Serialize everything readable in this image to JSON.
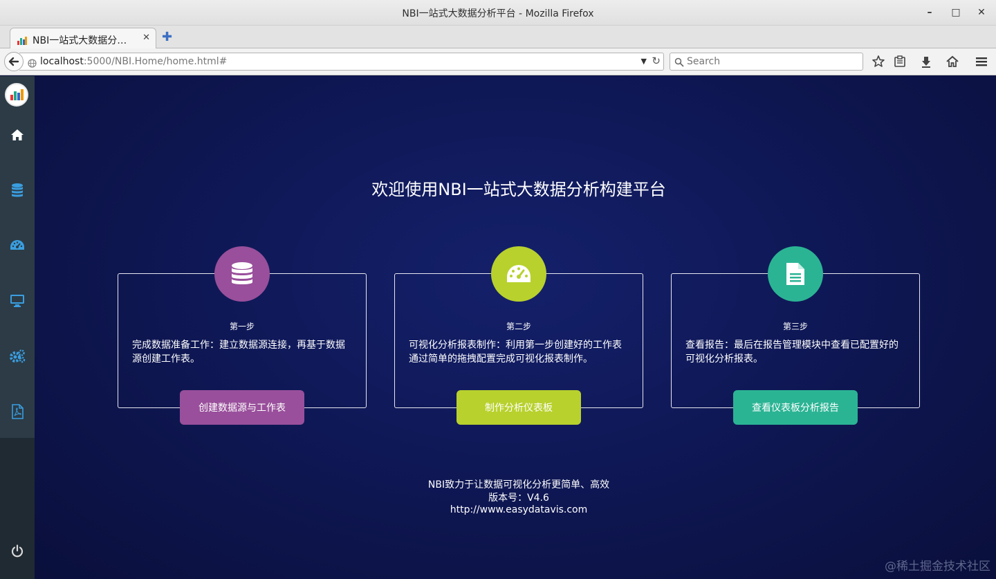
{
  "window": {
    "title": "NBI一站式大数据分析平台 - Mozilla Firefox",
    "minimize": "–",
    "maximize": "□",
    "close": "✕"
  },
  "browser": {
    "tab_title": "NBI一站式大数据分…",
    "tab_close": "✕",
    "new_tab": "✚",
    "url_host": "localhost",
    "url_rest": ":5000/NBI.Home/home.html#",
    "search_placeholder": "Search"
  },
  "sidebar": {
    "items": [
      {
        "icon": "home-icon"
      },
      {
        "icon": "database-icon"
      },
      {
        "icon": "dashboard-icon"
      },
      {
        "icon": "monitor-icon"
      },
      {
        "icon": "settings-icon"
      },
      {
        "icon": "pdf-icon"
      }
    ],
    "power_icon": "power-icon"
  },
  "main": {
    "welcome": "欢迎使用NBI一站式大数据分析构建平台",
    "cards": [
      {
        "step": "第一步",
        "description": "完成数据准备工作：建立数据源连接，再基于数据源创建工作表。",
        "button": "创建数据源与工作表",
        "color": "#994f9b",
        "icon": "database-icon"
      },
      {
        "step": "第二步",
        "description": "可视化分析报表制作：利用第一步创建好的工作表通过简单的拖拽配置完成可视化报表制作。",
        "button": "制作分析仪表板",
        "color": "#b8d12d",
        "icon": "dashboard-icon"
      },
      {
        "step": "第三步",
        "description": "查看报告：最后在报告管理模块中查看已配置好的可视化分析报表。",
        "button": "查看仪表板分析报告",
        "color": "#2bb494",
        "icon": "document-icon"
      }
    ],
    "footer": {
      "slogan": "NBI致力于让数据可视化分析更简单、高效",
      "version": "版本号：V4.6",
      "website": "http://www.easydatavis.com"
    },
    "watermark": "@稀土掘金技术社区"
  }
}
